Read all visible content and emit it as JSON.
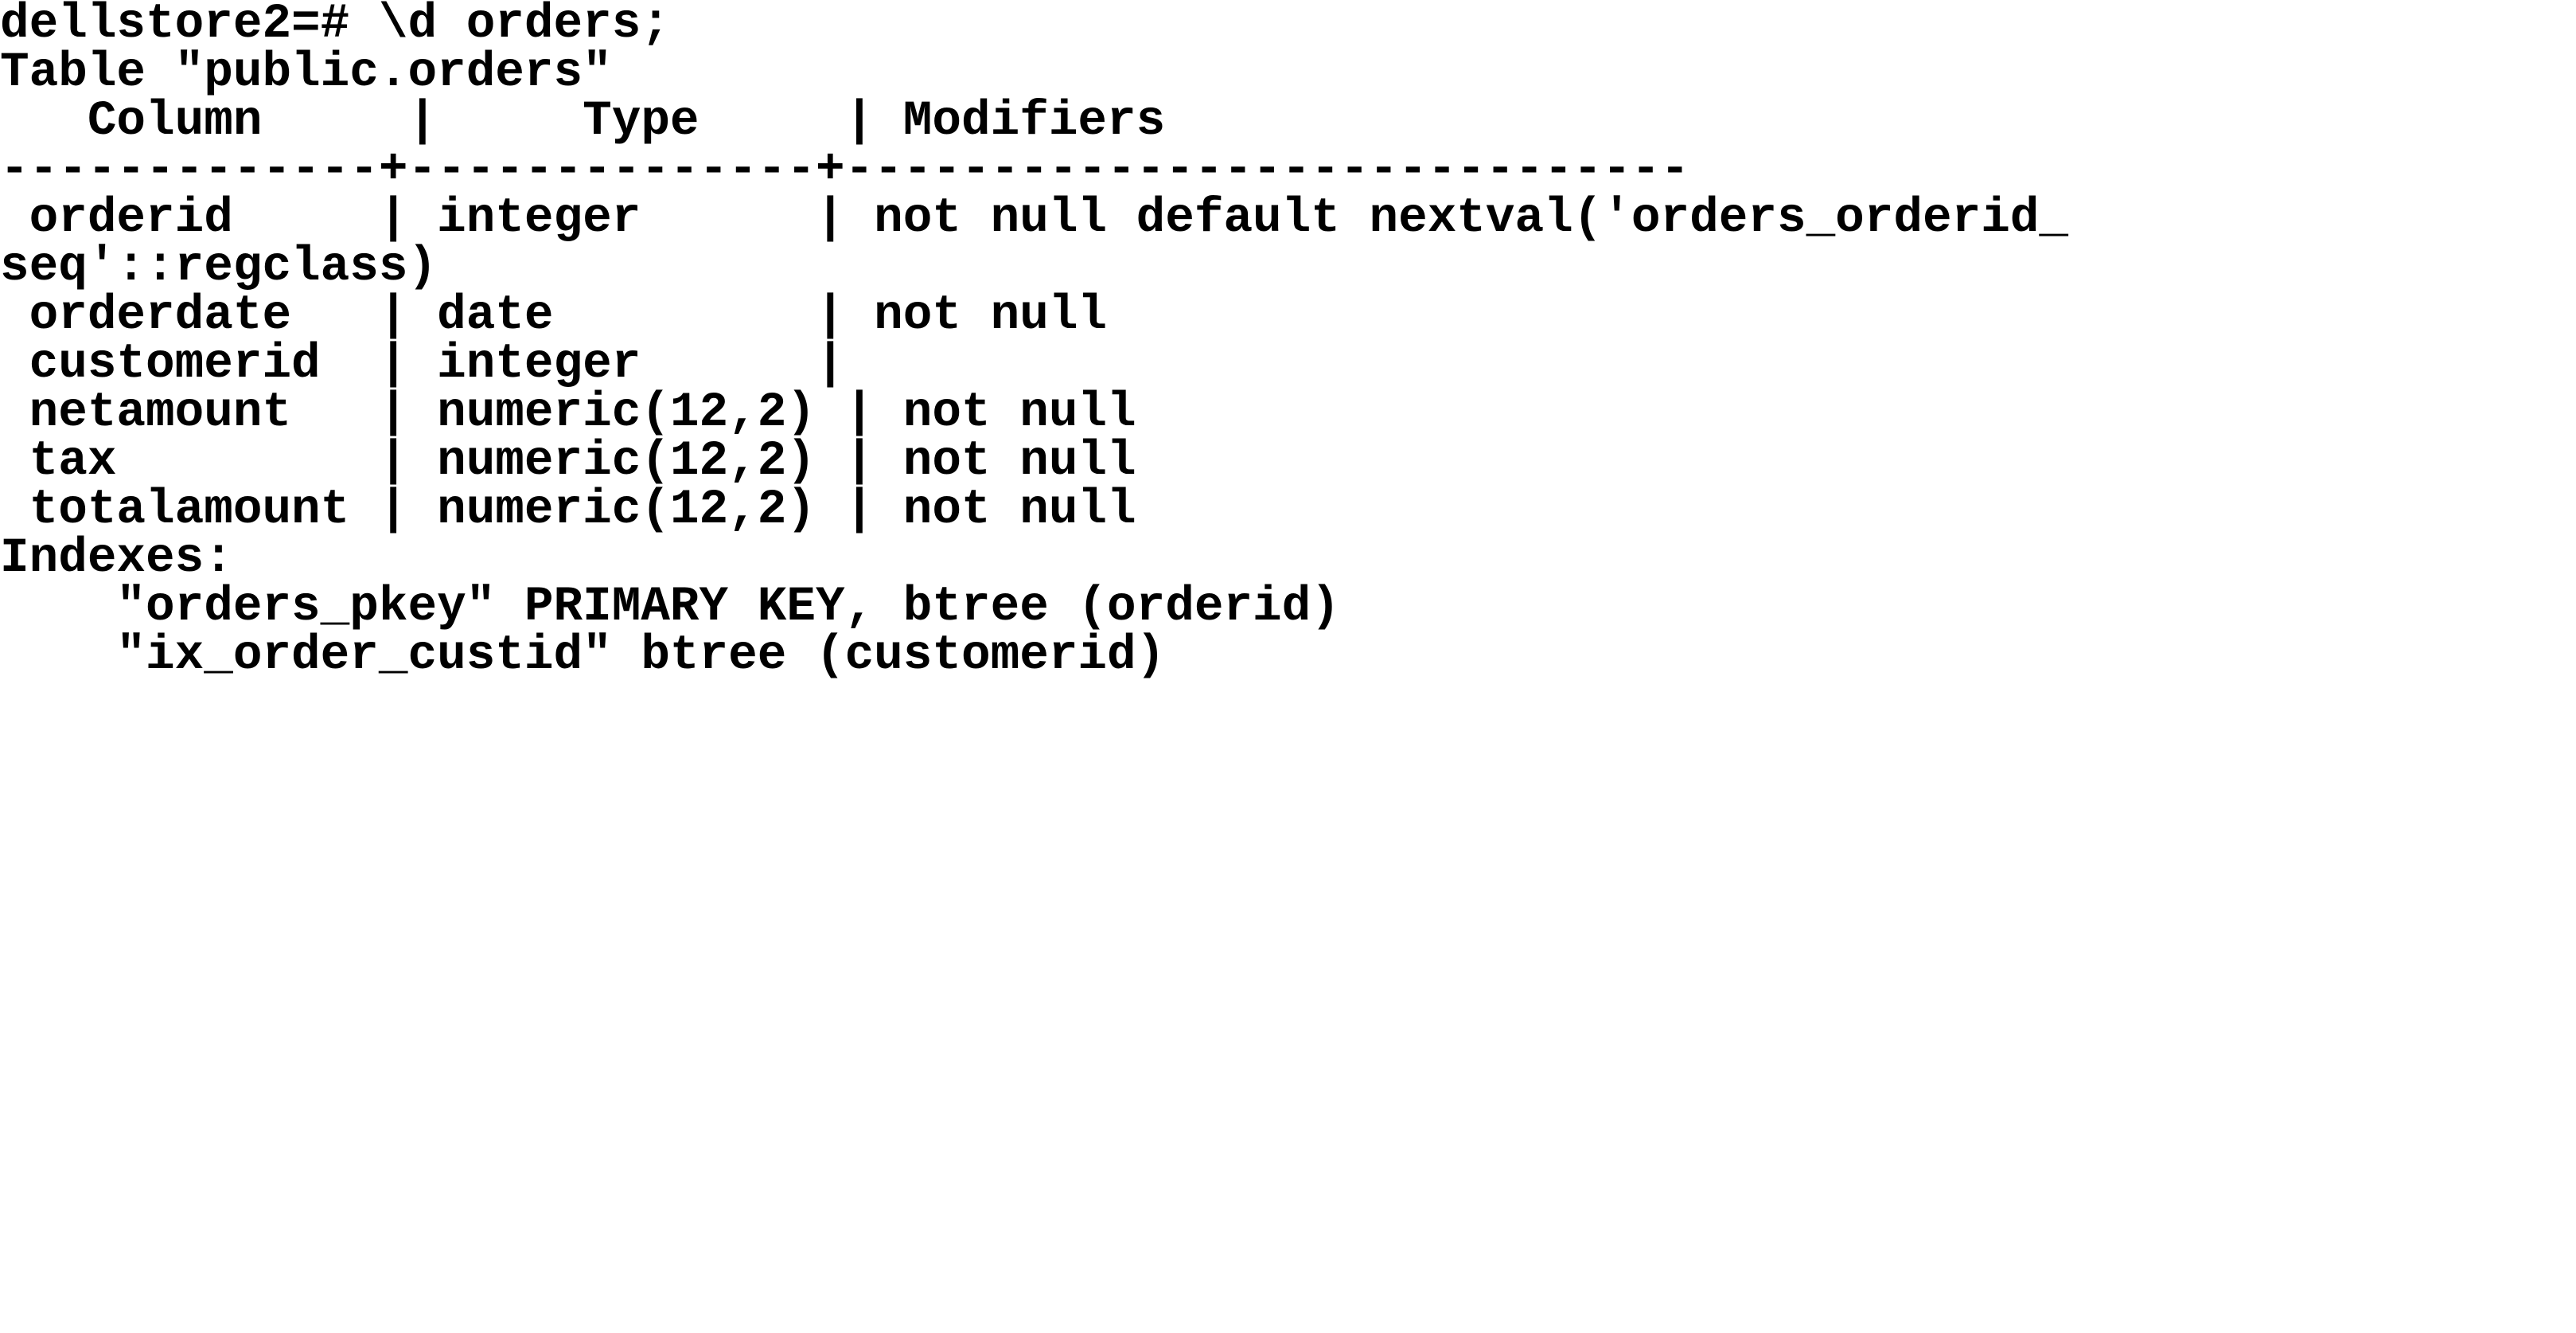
{
  "terminal": {
    "app": "psql",
    "background_color": "#ffffff",
    "foreground_color": "#000000",
    "prompt": "dellstore2=#",
    "command": "\\d orders;",
    "prompt_line": "dellstore2=# \\d orders;",
    "table_caption": "Table \"public.orders\"",
    "columns_header": {
      "column": "Column",
      "type": "Type",
      "modifiers": "Modifiers"
    },
    "header_line": "   Column     |     Type     | Modifiers",
    "separator_line": "-------------+--------------+-----------------------------",
    "rows": [
      {
        "column": "orderid",
        "type": "integer",
        "modifiers": "not null default nextval('orders_orderid_seq'::regclass)",
        "line": " orderid     | integer      | not null default nextval('orders_orderid_",
        "wrapped_continuation": "seq'::regclass)"
      },
      {
        "column": "orderdate",
        "type": "date",
        "modifiers": "not null",
        "line": " orderdate   | date         | not null",
        "wrapped_continuation": ""
      },
      {
        "column": "customerid",
        "type": "integer",
        "modifiers": "",
        "line": " customerid  | integer      |",
        "wrapped_continuation": ""
      },
      {
        "column": "netamount",
        "type": "numeric(12,2)",
        "modifiers": "not null",
        "line": " netamount   | numeric(12,2) | not null",
        "wrapped_continuation": ""
      },
      {
        "column": "tax",
        "type": "numeric(12,2)",
        "modifiers": "not null",
        "line": " tax         | numeric(12,2) | not null",
        "wrapped_continuation": ""
      },
      {
        "column": "totalamount",
        "type": "numeric(12,2)",
        "modifiers": "not null",
        "line": " totalamount | numeric(12,2) | not null",
        "wrapped_continuation": ""
      }
    ],
    "indexes_label": "Indexes:",
    "indexes": [
      {
        "name": "\"orders_pkey\"",
        "definition": "PRIMARY KEY, btree (orderid)",
        "line": "    \"orders_pkey\" PRIMARY KEY, btree (orderid)"
      },
      {
        "name": "\"ix_order_custid\"",
        "definition": "btree (customerid)",
        "line": "    \"ix_order_custid\" btree (customerid)"
      }
    ],
    "lines": [
      "dellstore2=# \\d orders;",
      "Table \"public.orders\"",
      "   Column     |     Type     | Modifiers",
      "-------------+--------------+-----------------------------",
      " orderid     | integer      | not null default nextval('orders_orderid_",
      "seq'::regclass)",
      " orderdate   | date         | not null",
      " customerid  | integer      |",
      " netamount   | numeric(12,2) | not null",
      " tax         | numeric(12,2) | not null",
      " totalamount | numeric(12,2) | not null",
      "Indexes:",
      "    \"orders_pkey\" PRIMARY KEY, btree (orderid)",
      "    \"ix_order_custid\" btree (customerid)"
    ]
  }
}
